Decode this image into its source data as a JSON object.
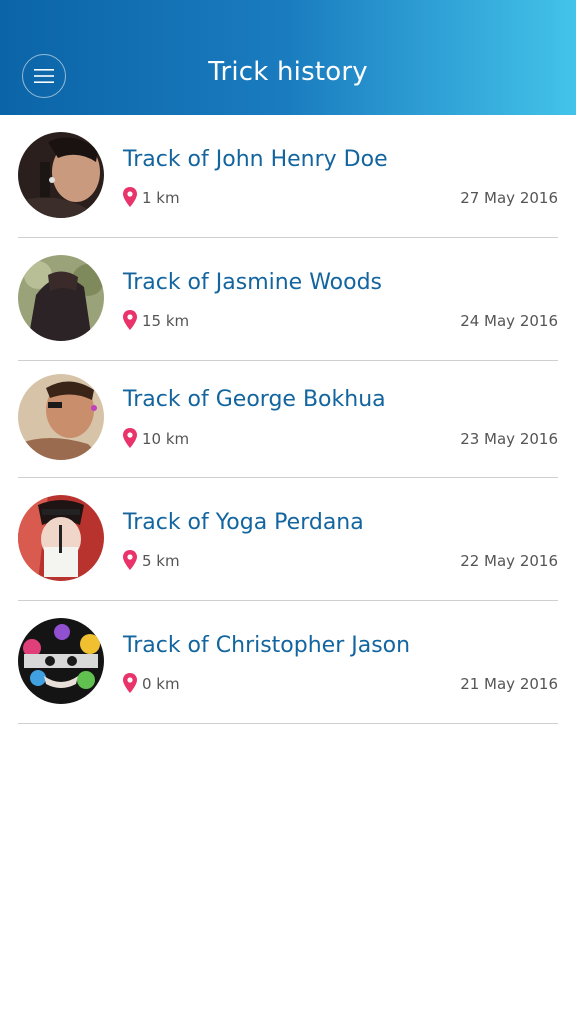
{
  "header": {
    "title": "Trick history",
    "menu_icon": "hamburger-menu-icon",
    "gradient_start": "#0b64a7",
    "gradient_end": "#43c3ea"
  },
  "colors": {
    "name_text": "#13659f",
    "pin": "#e8336b",
    "meta_text": "#555555",
    "divider": "#cfcfcf"
  },
  "tracks": [
    {
      "name": "Track of John Henry Doe",
      "distance": "1 km",
      "date": "27 May 2016",
      "avatar_icon": "avatar-photo"
    },
    {
      "name": "Track of Jasmine Woods",
      "distance": "15 km",
      "date": "24 May 2016",
      "avatar_icon": "avatar-photo"
    },
    {
      "name": "Track of George Bokhua",
      "distance": "10 km",
      "date": "23 May 2016",
      "avatar_icon": "avatar-photo"
    },
    {
      "name": "Track of Yoga Perdana",
      "distance": "5 km",
      "date": "22 May 2016",
      "avatar_icon": "avatar-photo"
    },
    {
      "name": "Track of Christopher Jason",
      "distance": "0 km",
      "date": "21 May 2016",
      "avatar_icon": "avatar-photo"
    }
  ]
}
